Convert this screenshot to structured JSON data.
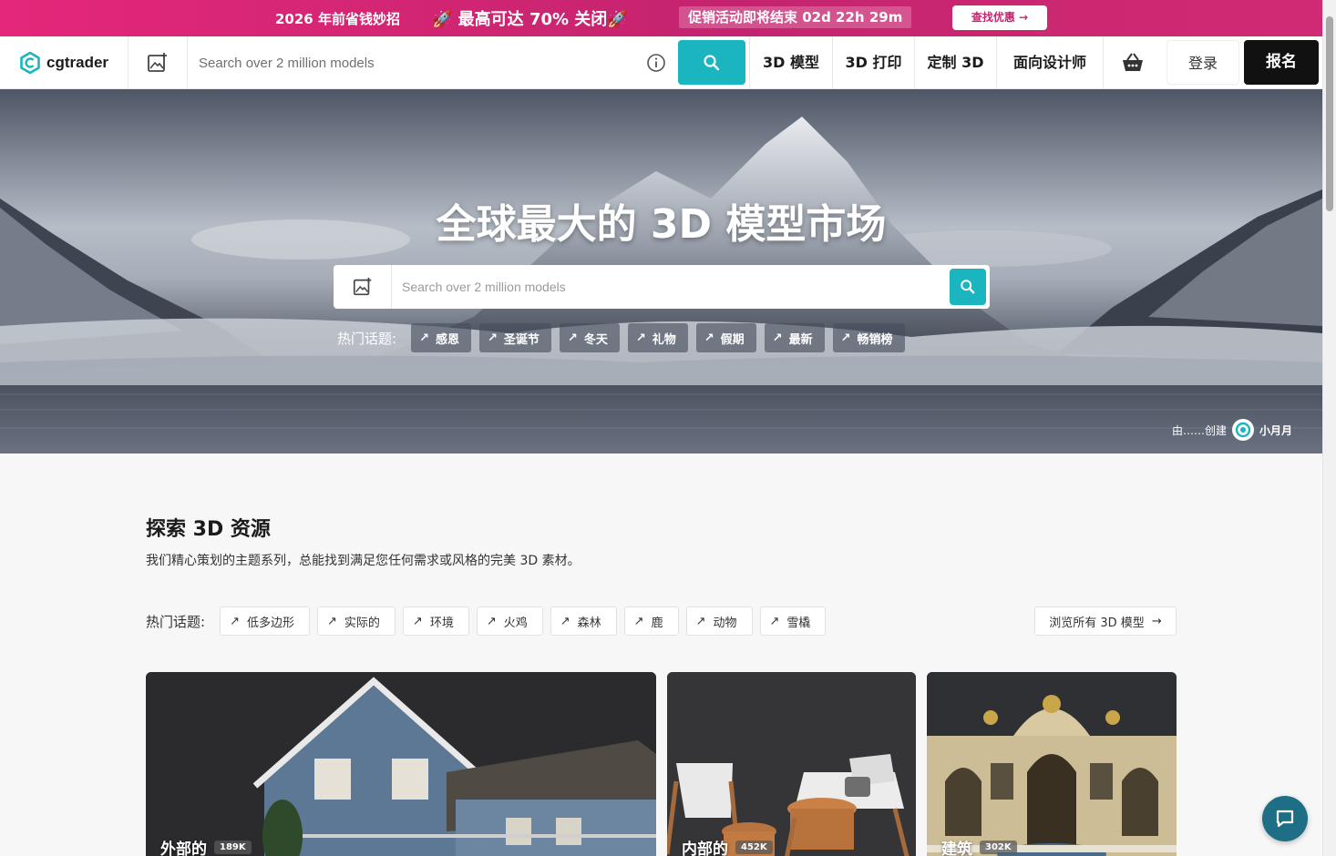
{
  "promo": {
    "headline": "2026 年前省钱妙招",
    "offer": "🚀 最高可达 70% 关闭🚀",
    "countdown": "促销活动即将结束 02d 22h 29m",
    "cta": "查找优惠 →"
  },
  "header": {
    "logo_text": "cgtrader",
    "search_placeholder": "Search over 2 million models",
    "nav": [
      "3D 模型",
      "3D 打印",
      "定制 3D",
      "面向设计师"
    ],
    "login": "登录",
    "signup": "报名"
  },
  "hero": {
    "title": "全球最大的 3D 模型市场",
    "search_placeholder": "Search over 2 million models",
    "topics_label": "热门话题:",
    "topics": [
      "感恩",
      "圣诞节",
      "冬天",
      "礼物",
      "假期",
      "最新",
      "畅销榜"
    ],
    "credit_prefix": "由……创建",
    "credit_name": "小月月"
  },
  "explore": {
    "title": "探索 3D 资源",
    "subtitle": "我们精心策划的主题系列，总能找到满足您任何需求或风格的完美 3D 素材。",
    "topics_label": "热门话题:",
    "topics": [
      "低多边形",
      "实际的",
      "环境",
      "火鸡",
      "森林",
      "鹿",
      "动物",
      "雪橇"
    ],
    "browse_all": "浏览所有 3D 模型"
  },
  "cards": [
    {
      "title": "外部的",
      "count": "189K"
    },
    {
      "title": "内部的",
      "count": "452K"
    },
    {
      "title": "建筑",
      "count": "302K"
    }
  ],
  "colors": {
    "accent": "#1ab5be",
    "promo": "#d12a74",
    "dark": "#111111"
  }
}
